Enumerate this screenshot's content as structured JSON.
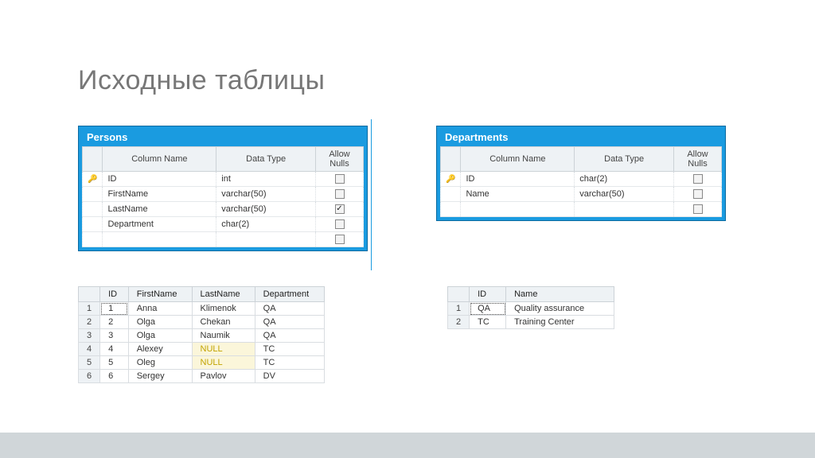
{
  "title": "Исходные таблицы",
  "schemas": {
    "persons": {
      "name": "Persons",
      "headers": {
        "col": "Column Name",
        "type": "Data Type",
        "nulls": "Allow Nulls"
      },
      "rows": [
        {
          "pk": true,
          "col": "ID",
          "type": "int",
          "nulls": false
        },
        {
          "pk": false,
          "col": "FirstName",
          "type": "varchar(50)",
          "nulls": false
        },
        {
          "pk": false,
          "col": "LastName",
          "type": "varchar(50)",
          "nulls": true
        },
        {
          "pk": false,
          "col": "Department",
          "type": "char(2)",
          "nulls": false
        },
        {
          "pk": false,
          "col": "",
          "type": "",
          "nulls": false
        }
      ]
    },
    "departments": {
      "name": "Departments",
      "headers": {
        "col": "Column Name",
        "type": "Data Type",
        "nulls": "Allow Nulls"
      },
      "rows": [
        {
          "pk": true,
          "col": "ID",
          "type": "char(2)",
          "nulls": false
        },
        {
          "pk": false,
          "col": "Name",
          "type": "varchar(50)",
          "nulls": false
        },
        {
          "pk": false,
          "col": "",
          "type": "",
          "nulls": false
        }
      ]
    }
  },
  "grids": {
    "persons": {
      "headers": [
        "ID",
        "FirstName",
        "LastName",
        "Department"
      ],
      "rows": [
        {
          "n": "1",
          "cells": [
            "1",
            "Anna",
            "Klimenok",
            "QA"
          ],
          "nullIdx": []
        },
        {
          "n": "2",
          "cells": [
            "2",
            "Olga",
            "Chekan",
            "QA"
          ],
          "nullIdx": []
        },
        {
          "n": "3",
          "cells": [
            "3",
            "Olga",
            "Naumik",
            "QA"
          ],
          "nullIdx": []
        },
        {
          "n": "4",
          "cells": [
            "4",
            "Alexey",
            "NULL",
            "TC"
          ],
          "nullIdx": [
            2
          ]
        },
        {
          "n": "5",
          "cells": [
            "5",
            "Oleg",
            "NULL",
            "TC"
          ],
          "nullIdx": [
            2
          ]
        },
        {
          "n": "6",
          "cells": [
            "6",
            "Sergey",
            "Pavlov",
            "DV"
          ],
          "nullIdx": []
        }
      ]
    },
    "departments": {
      "headers": [
        "ID",
        "Name"
      ],
      "rows": [
        {
          "n": "1",
          "cells": [
            "QA",
            "Quality assurance"
          ],
          "nullIdx": []
        },
        {
          "n": "2",
          "cells": [
            "TC",
            "Training Center"
          ],
          "nullIdx": []
        }
      ]
    }
  }
}
